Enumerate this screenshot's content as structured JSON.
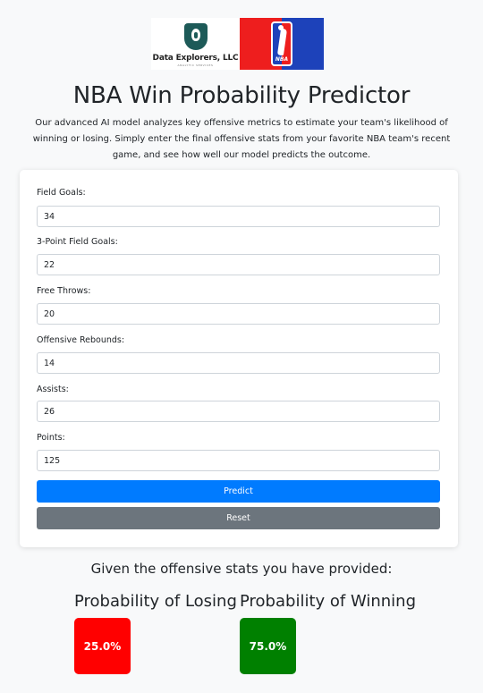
{
  "logos": {
    "company_name": "Data Explorers, LLC",
    "company_tagline": "ANALYTIC SERVICES",
    "league_mark": "NBA"
  },
  "page": {
    "title": "NBA Win Probability Predictor",
    "intro": "Our advanced AI model analyzes key offensive metrics to estimate your team's likelihood of winning or losing. Simply enter the final offensive stats from your favorite NBA team's recent game, and see how well our model predicts the outcome."
  },
  "form": {
    "fields": [
      {
        "label": "Field Goals:",
        "value": "34"
      },
      {
        "label": "3-Point Field Goals:",
        "value": "22"
      },
      {
        "label": "Free Throws:",
        "value": "20"
      },
      {
        "label": "Offensive Rebounds:",
        "value": "14"
      },
      {
        "label": "Assists:",
        "value": "26"
      },
      {
        "label": "Points:",
        "value": "125"
      }
    ],
    "predict_label": "Predict",
    "reset_label": "Reset"
  },
  "results": {
    "heading": "Given the offensive stats you have provided:",
    "losing": {
      "title": "Probability of Losing",
      "value": "25.0%",
      "color": "#ff0000"
    },
    "winning": {
      "title": "Probability of Winning",
      "value": "75.0%",
      "color": "#008000"
    }
  },
  "colors": {
    "primary_button": "#007bff",
    "secondary_button": "#6c757d",
    "page_background": "#f8f9fa"
  }
}
